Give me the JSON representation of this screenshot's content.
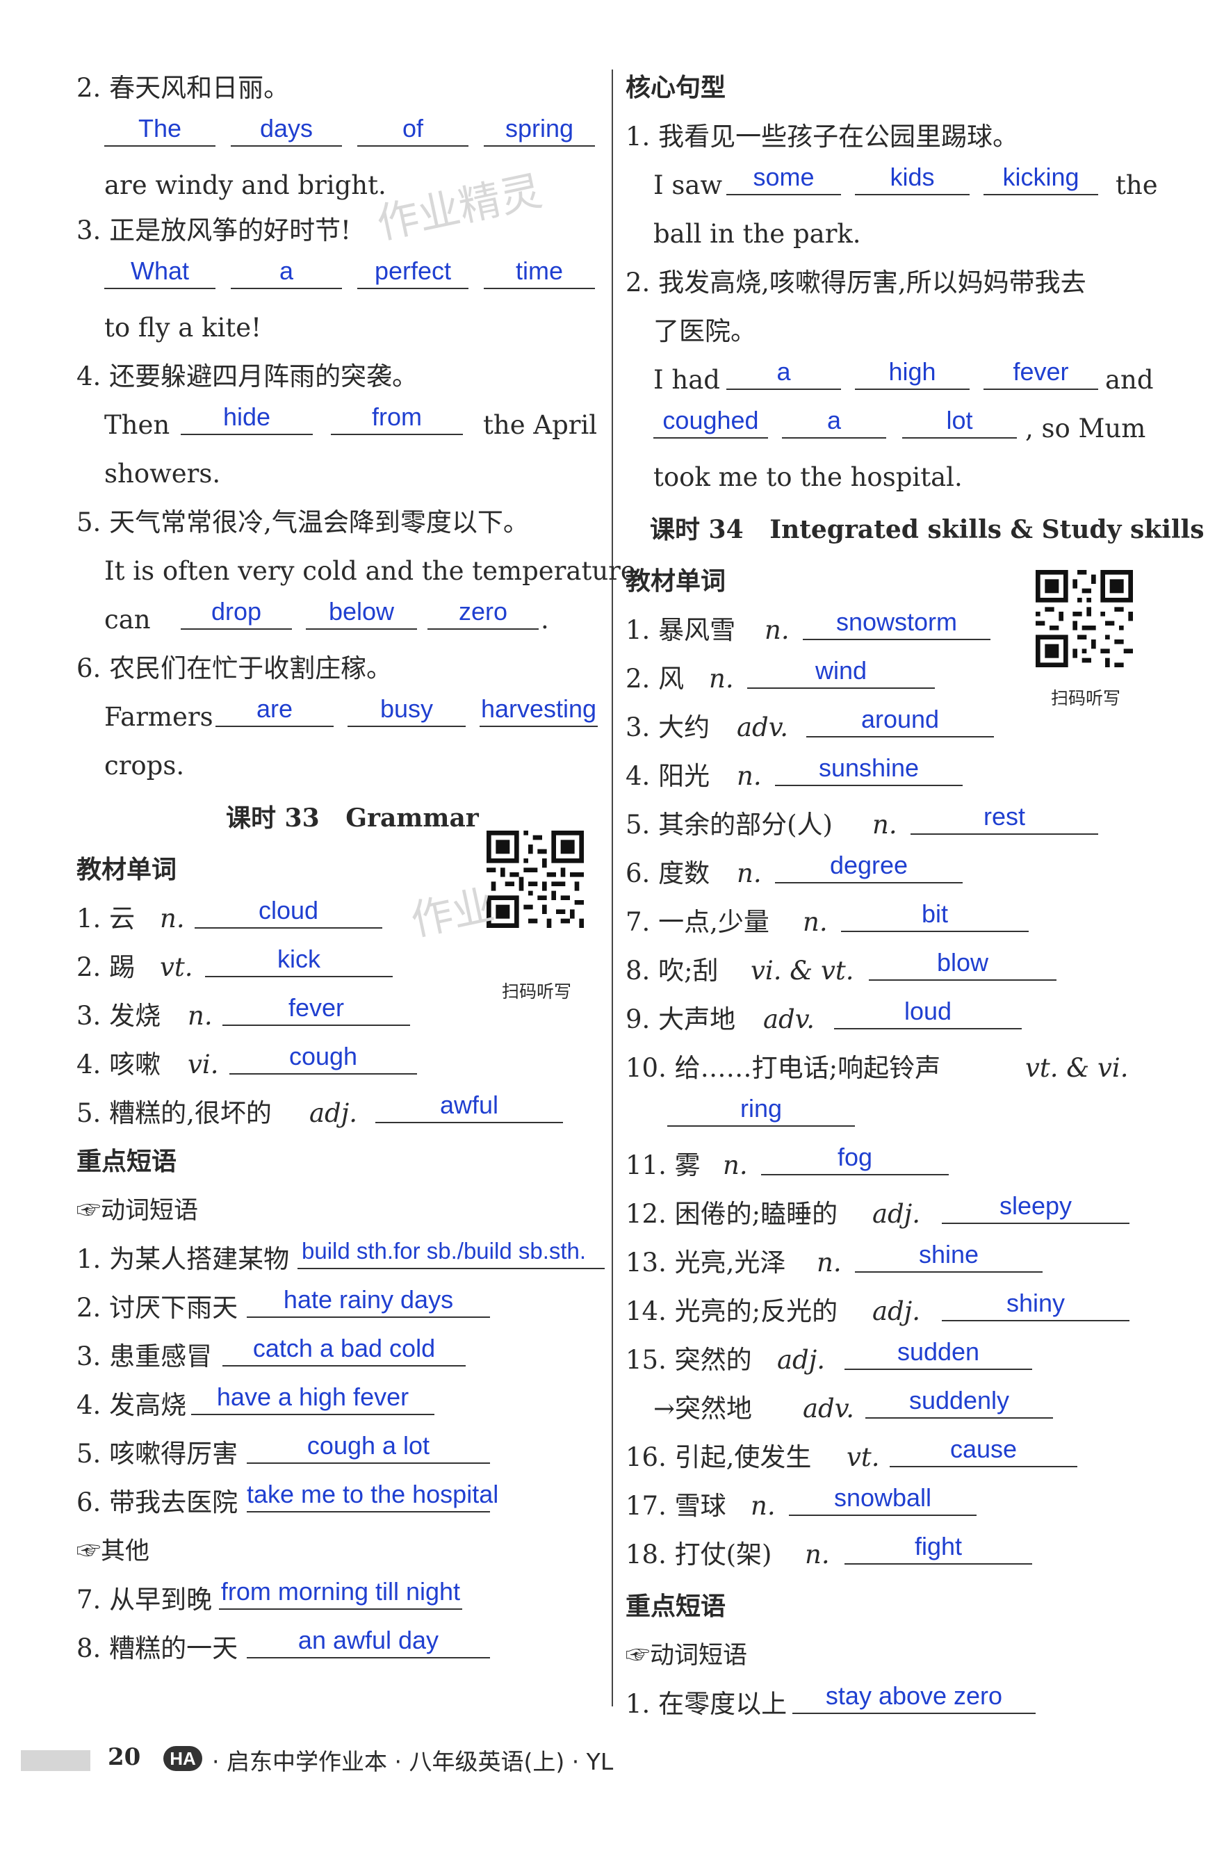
{
  "left": {
    "q2": {
      "cn": "2. 春天风和日丽。",
      "a1": "The",
      "a2": "days",
      "a3": "of",
      "a4": "spring",
      "cont": "are windy and bright."
    },
    "q3": {
      "cn": "3. 正是放风筝的好时节!",
      "a1": "What",
      "a2": "a",
      "a3": "perfect",
      "a4": "time",
      "cont": "to fly a kite!"
    },
    "q4": {
      "cn": "4. 还要躲避四月阵雨的突袭。",
      "pre": "Then",
      "a1": "hide",
      "a2": "from",
      "post": "the April",
      "cont": "showers."
    },
    "q5": {
      "cn": "5. 天气常常很冷,气温会降到零度以下。",
      "en1": "It is often very cold and the temperature",
      "pre": "can",
      "a1": "drop",
      "a2": "below",
      "a3": "zero",
      "end": "."
    },
    "q6": {
      "cn": "6. 农民们在忙于收割庄稼。",
      "pre": "Farmers",
      "a1": "are",
      "a2": "busy",
      "a3": "harvesting",
      "cont": "crops."
    },
    "lesson33": {
      "num": "课时 33",
      "name": "Grammar"
    },
    "vocab_head": "教材单词",
    "qr_label": "扫码听写",
    "vocab": [
      {
        "cn": "1. 云",
        "pos": "n.",
        "ans": "cloud"
      },
      {
        "cn": "2. 踢",
        "pos": "vt.",
        "ans": "kick"
      },
      {
        "cn": "3. 发烧",
        "pos": "n.",
        "ans": "fever"
      },
      {
        "cn": "4. 咳嗽",
        "pos": "vi.",
        "ans": "cough"
      },
      {
        "cn": "5. 糟糕的,很坏的",
        "pos": "adj.",
        "ans": "awful"
      }
    ],
    "phrase_head": "重点短语",
    "verb_phrase": "☞动词短语",
    "phrases": [
      {
        "cn": "1. 为某人搭建某物",
        "ans": "build sth.for sb./build sb.sth."
      },
      {
        "cn": "2. 讨厌下雨天",
        "ans": "hate rainy days"
      },
      {
        "cn": "3. 患重感冒",
        "ans": "catch a bad cold"
      },
      {
        "cn": "4. 发高烧",
        "ans": "have a high fever"
      },
      {
        "cn": "5. 咳嗽得厉害",
        "ans": "cough a lot"
      },
      {
        "cn": "6. 带我去医院",
        "ans": "take me to the hospital"
      }
    ],
    "other_head": "☞其他",
    "others": [
      {
        "cn": "7. 从早到晚",
        "ans": "from morning till night"
      },
      {
        "cn": "8. 糟糕的一天",
        "ans": "an awful day"
      }
    ]
  },
  "right": {
    "core_head": "核心句型",
    "c1": {
      "cn": "1. 我看见一些孩子在公园里踢球。",
      "pre": "I saw",
      "a1": "some",
      "a2": "kids",
      "a3": "kicking",
      "post": "the",
      "cont": "ball in the park."
    },
    "c2": {
      "cn1": "2. 我发高烧,咳嗽得厉害,所以妈妈带我去",
      "cn2": "了医院。",
      "pre": "I had",
      "a1": "a",
      "a2": "high",
      "a3": "fever",
      "post": "and",
      "a4": "coughed",
      "a5": "a",
      "a6": "lot",
      "post2": ", so Mum",
      "cont": "took me to the hospital."
    },
    "lesson34": {
      "num": "课时 34",
      "name": "Integrated skills & Study skills"
    },
    "vocab_head": "教材单词",
    "qr_label": "扫码听写",
    "vocab": [
      {
        "cn": "1. 暴风雪",
        "pos": "n.",
        "ans": "snowstorm"
      },
      {
        "cn": "2. 风",
        "pos": "n.",
        "ans": "wind"
      },
      {
        "cn": "3. 大约",
        "pos": "adv.",
        "ans": "around"
      },
      {
        "cn": "4. 阳光",
        "pos": "n.",
        "ans": "sunshine"
      },
      {
        "cn": "5. 其余的部分(人)",
        "pos": "n.",
        "ans": "rest"
      },
      {
        "cn": "6. 度数",
        "pos": "n.",
        "ans": "degree"
      },
      {
        "cn": "7. 一点,少量",
        "pos": "n.",
        "ans": "bit"
      },
      {
        "cn": "8. 吹;刮",
        "pos": "vi. & vt.",
        "ans": "blow"
      },
      {
        "cn": "9. 大声地",
        "pos": "adv.",
        "ans": "loud"
      },
      {
        "cn": "10. 给……打电话;响起铃声",
        "pos": "vt. & vi.",
        "ans": "ring"
      },
      {
        "cn": "11. 雾",
        "pos": "n.",
        "ans": "fog"
      },
      {
        "cn": "12. 困倦的;瞌睡的",
        "pos": "adj.",
        "ans": "sleepy"
      },
      {
        "cn": "13. 光亮,光泽",
        "pos": "n.",
        "ans": "shine"
      },
      {
        "cn": "14. 光亮的;反光的",
        "pos": "adj.",
        "ans": "shiny"
      },
      {
        "cn": "15. 突然的",
        "pos": "adj.",
        "ans": "sudden"
      },
      {
        "cn": "→突然地",
        "pos": "adv.",
        "ans": "suddenly"
      },
      {
        "cn": "16. 引起,使发生",
        "pos": "vt.",
        "ans": "cause"
      },
      {
        "cn": "17. 雪球",
        "pos": "n.",
        "ans": "snowball"
      },
      {
        "cn": "18. 打仗(架)",
        "pos": "n.",
        "ans": "fight"
      }
    ],
    "phrase_head": "重点短语",
    "verb_phrase": "☞动词短语",
    "phrases": [
      {
        "cn": "1. 在零度以上",
        "ans": "stay above zero"
      }
    ]
  },
  "watermarks": {
    "w1": "作业精灵",
    "w2": "作业"
  },
  "footer": {
    "page": "20",
    "badge": "HA",
    "title": "· 启东中学作业本 · 八年级英语(上) · YL"
  }
}
